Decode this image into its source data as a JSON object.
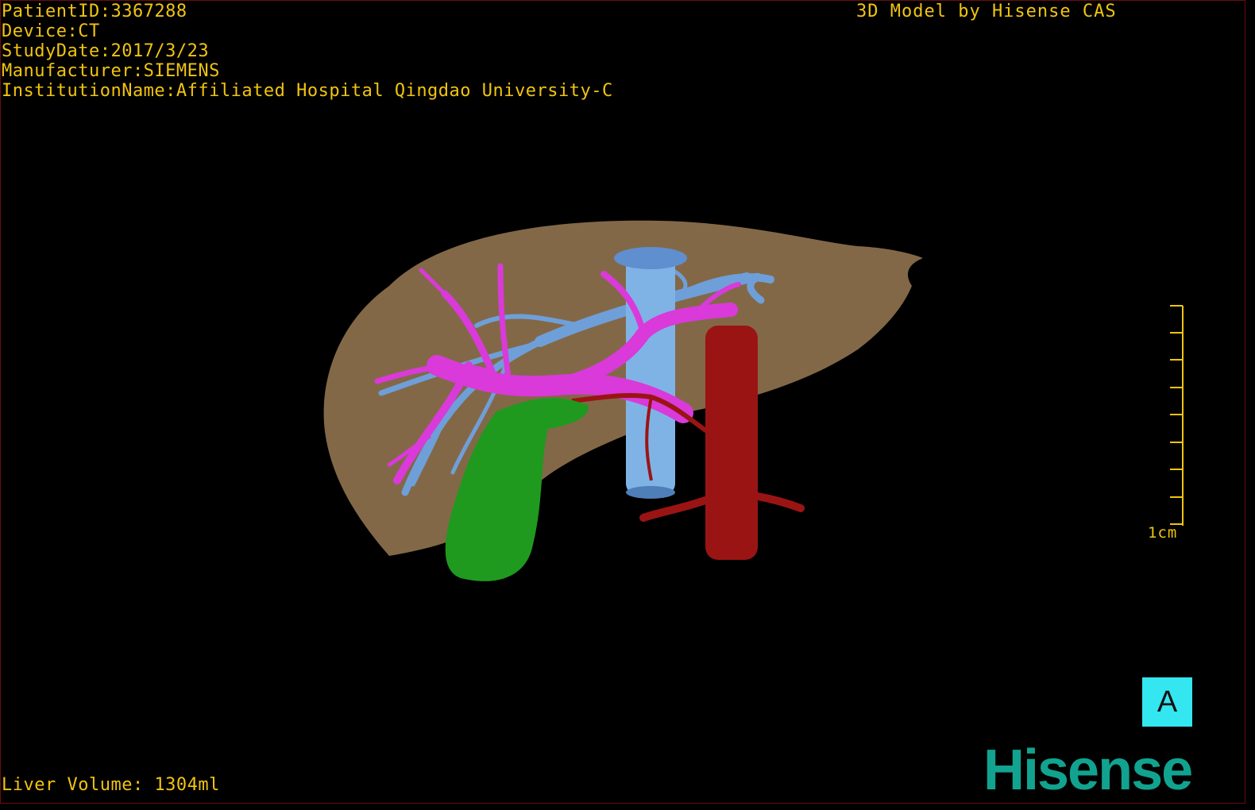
{
  "info": {
    "patient_id": "PatientID:3367288",
    "device": "Device:CT",
    "study_date": "StudyDate:2017/3/23",
    "manufacturer": "Manufacturer:SIEMENS",
    "institution": "InstitutionName:Affiliated Hospital Qingdao University-C"
  },
  "credit": "3D Model by Hisense CAS",
  "liver_volume": "Liver Volume: 1304ml",
  "scale_label": "1cm",
  "orientation_label": "A",
  "logo_text": "Hisense",
  "colors": {
    "overlay_text": "#f1c40f",
    "liver": "#8a6e4c",
    "portal_vein": "#d93ad9",
    "hepatic_vein": "#6f9fd8",
    "ivc": "#7fb3e6",
    "aorta": "#9b1414",
    "gallbladder": "#1f9a1f",
    "orientation_bg": "#33e6f0",
    "logo": "#11a38f"
  }
}
